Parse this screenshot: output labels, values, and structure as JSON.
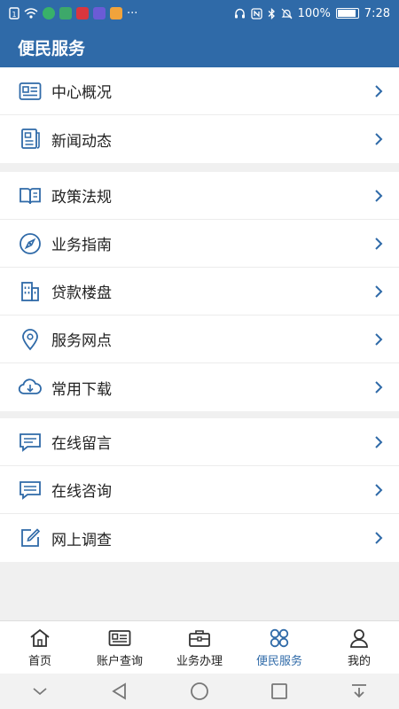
{
  "status_bar": {
    "battery": "100%",
    "time": "7:28",
    "more": "···",
    "chip_colors": [
      "#38b16a",
      "#d9363e",
      "#6b5bd6",
      "#f1a33b"
    ]
  },
  "header": {
    "title": "便民服务"
  },
  "groups": [
    {
      "items": [
        {
          "label": "中心概况",
          "icon": "id-card-icon"
        },
        {
          "label": "新闻动态",
          "icon": "newspaper-icon"
        }
      ]
    },
    {
      "items": [
        {
          "label": "政策法规",
          "icon": "book-icon"
        },
        {
          "label": "业务指南",
          "icon": "compass-icon"
        },
        {
          "label": "贷款楼盘",
          "icon": "building-icon"
        },
        {
          "label": "服务网点",
          "icon": "location-pin-icon"
        },
        {
          "label": "常用下载",
          "icon": "cloud-download-icon"
        }
      ]
    },
    {
      "items": [
        {
          "label": "在线留言",
          "icon": "message-icon"
        },
        {
          "label": "在线咨询",
          "icon": "chat-icon"
        },
        {
          "label": "网上调查",
          "icon": "edit-icon"
        }
      ]
    }
  ],
  "tabbar": {
    "active": "便民服务",
    "tabs": [
      {
        "label": "首页",
        "icon": "home-icon"
      },
      {
        "label": "账户查询",
        "icon": "account-card-icon"
      },
      {
        "label": "业务办理",
        "icon": "briefcase-icon"
      },
      {
        "label": "便民服务",
        "icon": "grid-services-icon"
      },
      {
        "label": "我的",
        "icon": "person-icon"
      }
    ]
  },
  "colors": {
    "accent": "#2f6aa8",
    "icon": "#2f6aa8",
    "text": "#222222"
  }
}
